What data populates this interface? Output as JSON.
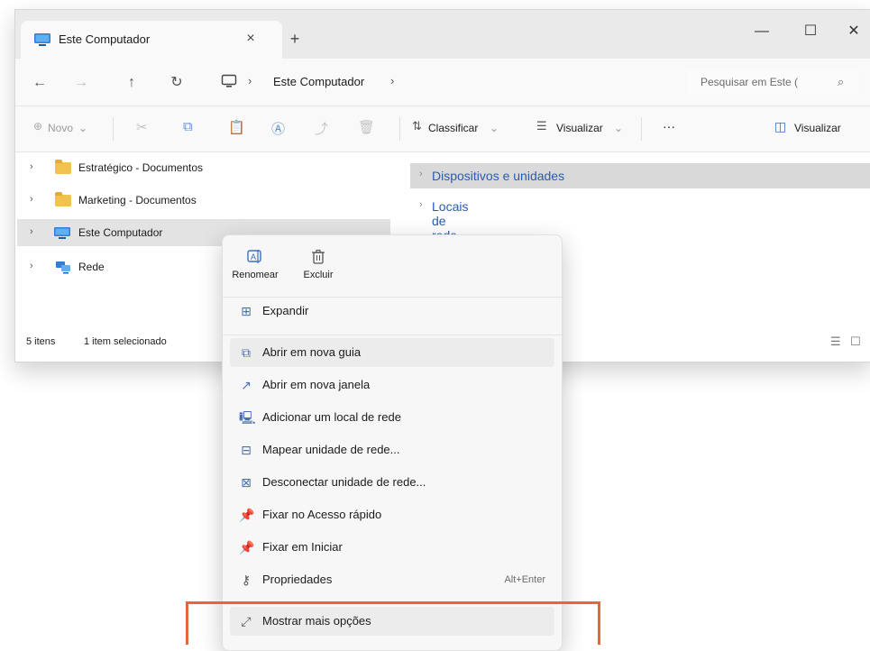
{
  "window": {
    "tab_title": "Este Computador",
    "tab_close": "×",
    "new_tab": "+",
    "minimize": "—",
    "maximize": "☐",
    "close": "✕"
  },
  "address": {
    "back": "←",
    "forward": "→",
    "up": "↑",
    "refresh": "↻",
    "sep1": "›",
    "crumb": "Este Computador",
    "sep2": "›",
    "search_placeholder": "Pesquisar em Este (",
    "search_icon": "⌕"
  },
  "commandbar": {
    "new_label": "Novo",
    "sort_label": "Classificar",
    "view_label": "Visualizar",
    "more": "···",
    "preview_label": "Visualizar"
  },
  "navpane": {
    "items": [
      {
        "label": "Estratégico - Documentos",
        "icon": "folder-icon"
      },
      {
        "label": "Marketing - Documentos",
        "icon": "folder-icon"
      },
      {
        "label": "Este Computador",
        "icon": "pc-icon"
      },
      {
        "label": "Rede",
        "icon": "network-icon"
      }
    ]
  },
  "content": {
    "groups": [
      {
        "label": "Dispositivos e unidades"
      },
      {
        "label": "Locais de rede"
      }
    ]
  },
  "status": {
    "count": "5 itens",
    "selection": "1 item selecionado"
  },
  "context_menu": {
    "quick": [
      {
        "label": "Renomear",
        "icon": "rename-icon"
      },
      {
        "label": "Excluir",
        "icon": "trash-icon"
      }
    ],
    "items": [
      {
        "label": "Expandir",
        "icon": "expand-icon",
        "shortcut": ""
      },
      {
        "label": "Abrir em nova guia",
        "icon": "open-tab-icon",
        "shortcut": ""
      },
      {
        "label": "Abrir em nova janela",
        "icon": "open-window-icon",
        "shortcut": ""
      },
      {
        "label": "Adicionar um local de rede",
        "icon": "add-network-location-icon",
        "shortcut": ""
      },
      {
        "label": "Mapear unidade de rede...",
        "icon": "map-drive-icon",
        "shortcut": ""
      },
      {
        "label": "Desconectar unidade de rede...",
        "icon": "disconnect-drive-icon",
        "shortcut": ""
      },
      {
        "label": "Fixar no Acesso rápido",
        "icon": "pin-icon",
        "shortcut": ""
      },
      {
        "label": "Fixar em Iniciar",
        "icon": "pin-icon",
        "shortcut": ""
      },
      {
        "label": "Propriedades",
        "icon": "key-icon",
        "shortcut": "Alt+Enter"
      },
      {
        "label": "Mostrar mais opções",
        "icon": "more-options-icon",
        "shortcut": ""
      }
    ]
  },
  "colors": {
    "highlight": "#e4673a",
    "link": "#2a5bb3",
    "folder": "#f2c34c"
  }
}
